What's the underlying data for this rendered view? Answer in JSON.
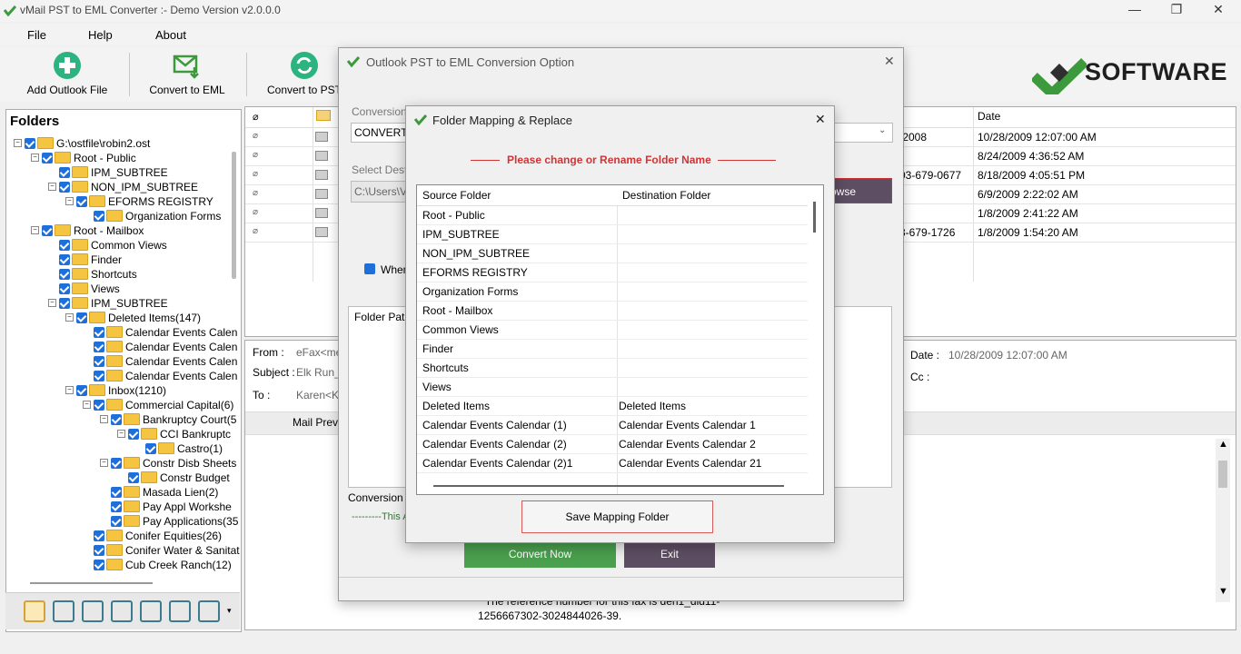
{
  "window": {
    "title": "vMail PST to EML Converter :- Demo Version v2.0.0.0",
    "minimize": "—",
    "restore": "❐",
    "close": "✕"
  },
  "menu": [
    "File",
    "Help",
    "About"
  ],
  "toolbar": {
    "add": "Add Outlook File",
    "convert_eml": "Convert to EML",
    "convert_pst": "Convert to PST"
  },
  "logo": {
    "text": "SOFTWARE",
    "color": "#3c9a3c"
  },
  "folders": {
    "header": "Folders",
    "items": [
      {
        "label": "G:\\ostfile\\robin2.ost"
      },
      {
        "label": "Root - Public"
      },
      {
        "label": "IPM_SUBTREE"
      },
      {
        "label": "NON_IPM_SUBTREE"
      },
      {
        "label": "EFORMS REGISTRY"
      },
      {
        "label": "Organization Forms"
      },
      {
        "label": "Root - Mailbox"
      },
      {
        "label": "Common Views"
      },
      {
        "label": "Finder"
      },
      {
        "label": "Shortcuts"
      },
      {
        "label": "Views"
      },
      {
        "label": "IPM_SUBTREE"
      },
      {
        "label": "Deleted Items(147)"
      },
      {
        "label": "Calendar Events Calen"
      },
      {
        "label": "Calendar Events Calen"
      },
      {
        "label": "Calendar Events Calen"
      },
      {
        "label": "Calendar Events Calen"
      },
      {
        "label": "Inbox(1210)"
      },
      {
        "label": "Commercial Capital(6)"
      },
      {
        "label": "Bankruptcy Court(5"
      },
      {
        "label": "CCI Bankruptc"
      },
      {
        "label": "Castro(1)"
      },
      {
        "label": "Constr Disb Sheets"
      },
      {
        "label": "Constr Budget"
      },
      {
        "label": "Masada Lien(2)"
      },
      {
        "label": "Pay Appl Workshe"
      },
      {
        "label": "Pay Applications(35"
      },
      {
        "label": "Conifer Equities(26)"
      },
      {
        "label": "Conifer Water & Sanitat"
      },
      {
        "label": "Cub Creek Ranch(12)"
      }
    ]
  },
  "list": {
    "date_header": "Date",
    "rows": [
      {
        "from": ";2008",
        "date": "10/28/2009 12:07:00 AM"
      },
      {
        "from": "",
        "date": "8/24/2009 4:36:52 AM"
      },
      {
        "from": "03-679-0677",
        "date": "8/18/2009 4:05:51 PM"
      },
      {
        "from": "",
        "date": "6/9/2009 2:22:02 AM"
      },
      {
        "from": "",
        "date": "1/8/2009 2:41:22 AM"
      },
      {
        "from": "3-679-1726",
        "date": "1/8/2009 1:54:20 AM"
      }
    ]
  },
  "preview": {
    "from_label": "From :",
    "from_value": "eFax<mes",
    "subject_label": "Subject :",
    "subject_value": "Elk Run_C",
    "to_label": "To :",
    "to_value": "Karen<Ka",
    "date_label": "Date :",
    "date_value": "10/28/2009 12:07:00 AM",
    "cc_label": "Cc :",
    "mail_preview": "Mail Previe",
    "body_line1": "* The reference number for this fax is den1_did11-",
    "body_line2": "1256667302-3024844026-39."
  },
  "conversion_dialog": {
    "title": "Outlook PST to EML Conversion Option",
    "conversion_label": "Conversion T",
    "conversion_value": "CONVERT",
    "dest_label": "Select Destin",
    "dest_value": "C:\\Users\\V",
    "browse": "owse",
    "checkbox_label": "When",
    "folder_path": "Folder Path",
    "conversion_status": "Conversion",
    "status_text": "---------This A",
    "convert_now": "Convert Now",
    "exit": "Exit",
    "close": "✕"
  },
  "mapping_dialog": {
    "title": "Folder Mapping & Replace",
    "close": "✕",
    "instruction": "Please change or Rename Folder Name",
    "instruction_color": "#d03434",
    "col_source": "Source Folder",
    "col_dest": "Destination Folder",
    "rows": [
      {
        "source": "Root - Public",
        "dest": ""
      },
      {
        "source": "IPM_SUBTREE",
        "dest": ""
      },
      {
        "source": "NON_IPM_SUBTREE",
        "dest": ""
      },
      {
        "source": "EFORMS REGISTRY",
        "dest": ""
      },
      {
        "source": "Organization Forms",
        "dest": ""
      },
      {
        "source": "Root - Mailbox",
        "dest": ""
      },
      {
        "source": "Common Views",
        "dest": ""
      },
      {
        "source": "Finder",
        "dest": ""
      },
      {
        "source": "Shortcuts",
        "dest": ""
      },
      {
        "source": "Views",
        "dest": ""
      },
      {
        "source": "Deleted Items",
        "dest": "Deleted Items"
      },
      {
        "source": "Calendar Events Calendar (1)",
        "dest": "Calendar Events Calendar 1"
      },
      {
        "source": "Calendar Events Calendar (2)",
        "dest": "Calendar Events Calendar 2"
      },
      {
        "source": "Calendar Events Calendar (2)1",
        "dest": "Calendar Events Calendar 21"
      }
    ],
    "save": "Save Mapping Folder"
  }
}
